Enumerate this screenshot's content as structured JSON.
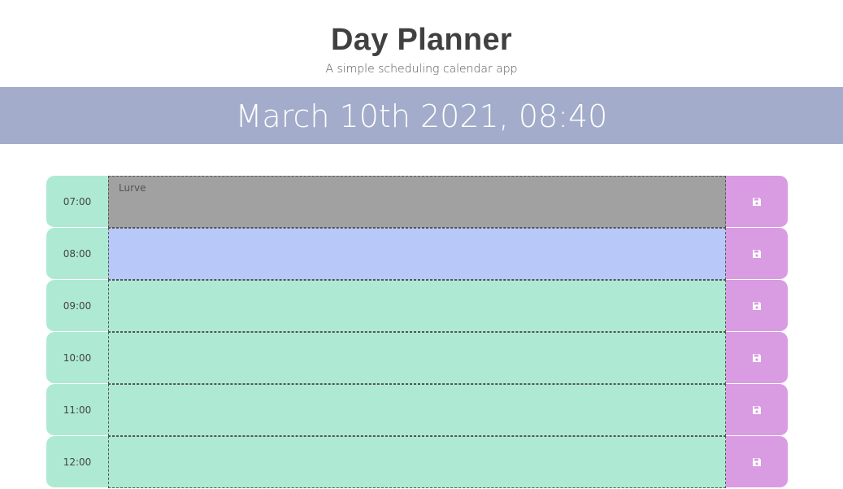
{
  "header": {
    "title": "Day Planner",
    "subtitle": "A simple scheduling calendar app"
  },
  "current_date": "March 10th 2021, 08:40",
  "colors": {
    "past": "#a1a1a1",
    "present": "#b8c8f8",
    "future": "#aeead3",
    "save": "#d99be2",
    "date_bar": "#a3acca"
  },
  "rows": [
    {
      "hour": "07:00",
      "text": "Lurve",
      "state": "past",
      "icon": "save-icon"
    },
    {
      "hour": "08:00",
      "text": "",
      "state": "present",
      "icon": "save-icon"
    },
    {
      "hour": "09:00",
      "text": "",
      "state": "future",
      "icon": "save-icon"
    },
    {
      "hour": "10:00",
      "text": "",
      "state": "future",
      "icon": "save-icon"
    },
    {
      "hour": "11:00",
      "text": "",
      "state": "future",
      "icon": "save-icon"
    },
    {
      "hour": "12:00",
      "text": "",
      "state": "future",
      "icon": "save-icon"
    }
  ]
}
